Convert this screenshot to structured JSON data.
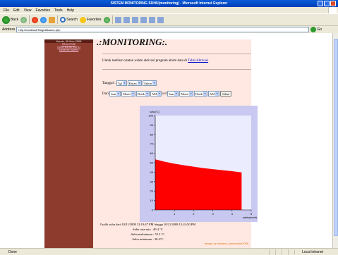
{
  "window": {
    "title": "SISTEM MONITORING SUHU(monitoring) - Microsoft Internet Explorer"
  },
  "menu": [
    "File",
    "Edit",
    "View",
    "Favorites",
    "Tools",
    "Help"
  ],
  "toolbar": {
    "back": "Back",
    "search": "Search",
    "favorites": "Favorites"
  },
  "address": {
    "label": "Address",
    "url": "http://localhost/TA/grafiksuhu.php",
    "go": "Go"
  },
  "sidebar": {
    "header": "Kamis, 06 Nov 2008",
    "links": [
      "REALTIME",
      "CARI DATA SUHU",
      "GRAFIK SUHU"
    ]
  },
  "content": {
    "heading": ".:MONITORING:.",
    "intro": "Untuk melihat catatan waktu aktivasi program alarm data di",
    "intro_link": "Tabel Aktivasi",
    "date_label": "Tanggal :",
    "date_selects": [
      "Tgl",
      "Bulan",
      "Tahun"
    ],
    "from_label": "Dari",
    "to_label": "s/d",
    "time_selects": [
      "Jam",
      "Menit",
      "Detik",
      "AM"
    ],
    "view_button": "Lihat",
    "info_lines": [
      "Grafik suhu dari 10/21/2008 12:19:47 PM hingga 10/21/2008 12:24:50 PM",
      "Suhu rata-rata : 40.4 °C",
      "Suhu maksimum : 55.2 °C",
      "Suhu minimum : 38.4°C"
    ],
    "credit": "design by widiana_kasmadian2008"
  },
  "chart_data": {
    "type": "area",
    "ylabel": "suhu(°C)",
    "xlabel": "waktu(menit)",
    "x": [
      0,
      0.5,
      1,
      1.5,
      2,
      2.5,
      3,
      3.5,
      4,
      4.5
    ],
    "y": [
      53.5,
      51.0,
      49.0,
      47.3,
      45.8,
      44.3,
      43.2,
      42.1,
      41.0,
      39.7
    ],
    "xticks": [
      1,
      2,
      3,
      4,
      5
    ],
    "yticks": [
      0,
      10,
      20,
      30,
      40,
      50,
      60,
      70,
      80,
      90,
      100
    ],
    "xlim": [
      0,
      5
    ],
    "ylim": [
      0,
      100
    ],
    "fill_color": "#ff0000",
    "plot_background": "#ececff",
    "frame_color": "#c8c8f0"
  },
  "statusbar": {
    "left": "Done",
    "right": "Local intranet"
  }
}
